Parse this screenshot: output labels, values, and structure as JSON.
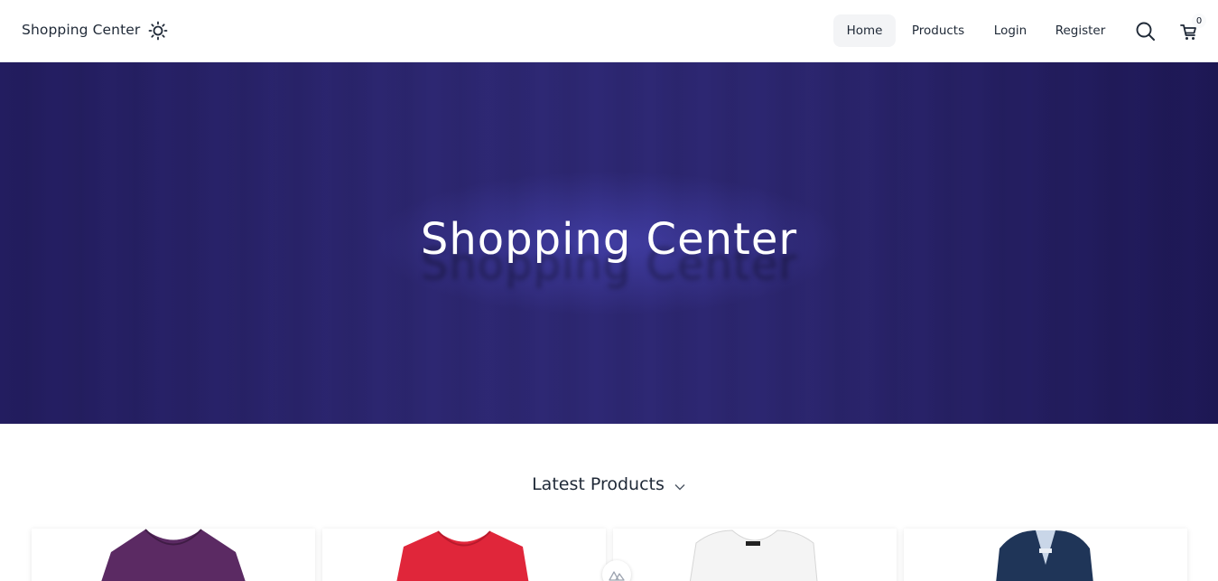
{
  "header": {
    "brand": "Shopping Center",
    "theme_icon": "sun-icon",
    "nav": [
      {
        "label": "Home",
        "active": true
      },
      {
        "label": "Products",
        "active": false
      },
      {
        "label": "Login",
        "active": false
      },
      {
        "label": "Register",
        "active": false
      }
    ],
    "search_icon": "search-icon",
    "cart_icon": "cart-icon",
    "cart_count": "0"
  },
  "hero": {
    "title": "Shopping Center",
    "background": "#2d2772"
  },
  "section": {
    "title": "Latest Products",
    "icon": "chevron-down-icon"
  },
  "products": [
    {
      "image": "purple-v-neck-tshirt",
      "color": "#5b2a63"
    },
    {
      "image": "red-v-neck-tshirt",
      "color": "#e0263a"
    },
    {
      "image": "white-top",
      "color": "#f2f2f2"
    },
    {
      "image": "navy-jacket",
      "color": "#1f3558"
    }
  ],
  "colors": {
    "accent": "#2d2772",
    "nav_active_bg": "#f3f4f6"
  }
}
